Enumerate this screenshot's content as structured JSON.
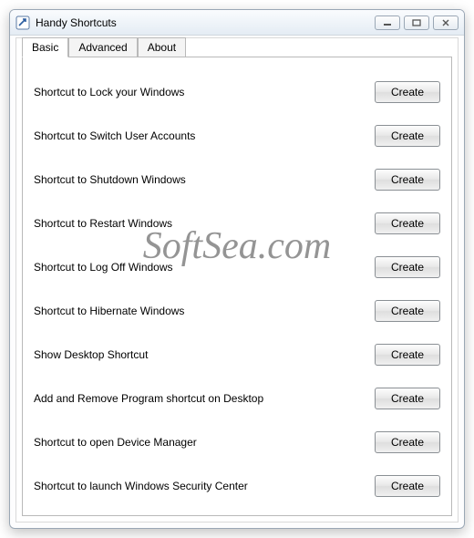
{
  "window": {
    "title": "Handy Shortcuts"
  },
  "tabs": [
    {
      "label": "Basic",
      "active": true
    },
    {
      "label": "Advanced",
      "active": false
    },
    {
      "label": "About",
      "active": false
    }
  ],
  "button_label": "Create",
  "rows": [
    {
      "label": "Shortcut to Lock your Windows"
    },
    {
      "label": "Shortcut to Switch User Accounts"
    },
    {
      "label": "Shortcut to Shutdown Windows"
    },
    {
      "label": "Shortcut to Restart Windows"
    },
    {
      "label": "Shortcut to Log Off Windows"
    },
    {
      "label": "Shortcut to Hibernate Windows"
    },
    {
      "label": "Show Desktop Shortcut"
    },
    {
      "label": "Add and Remove Program shortcut on Desktop"
    },
    {
      "label": "Shortcut to open Device Manager"
    },
    {
      "label": "Shortcut to launch Windows Security Center"
    }
  ],
  "watermark": "SoftSea.com"
}
